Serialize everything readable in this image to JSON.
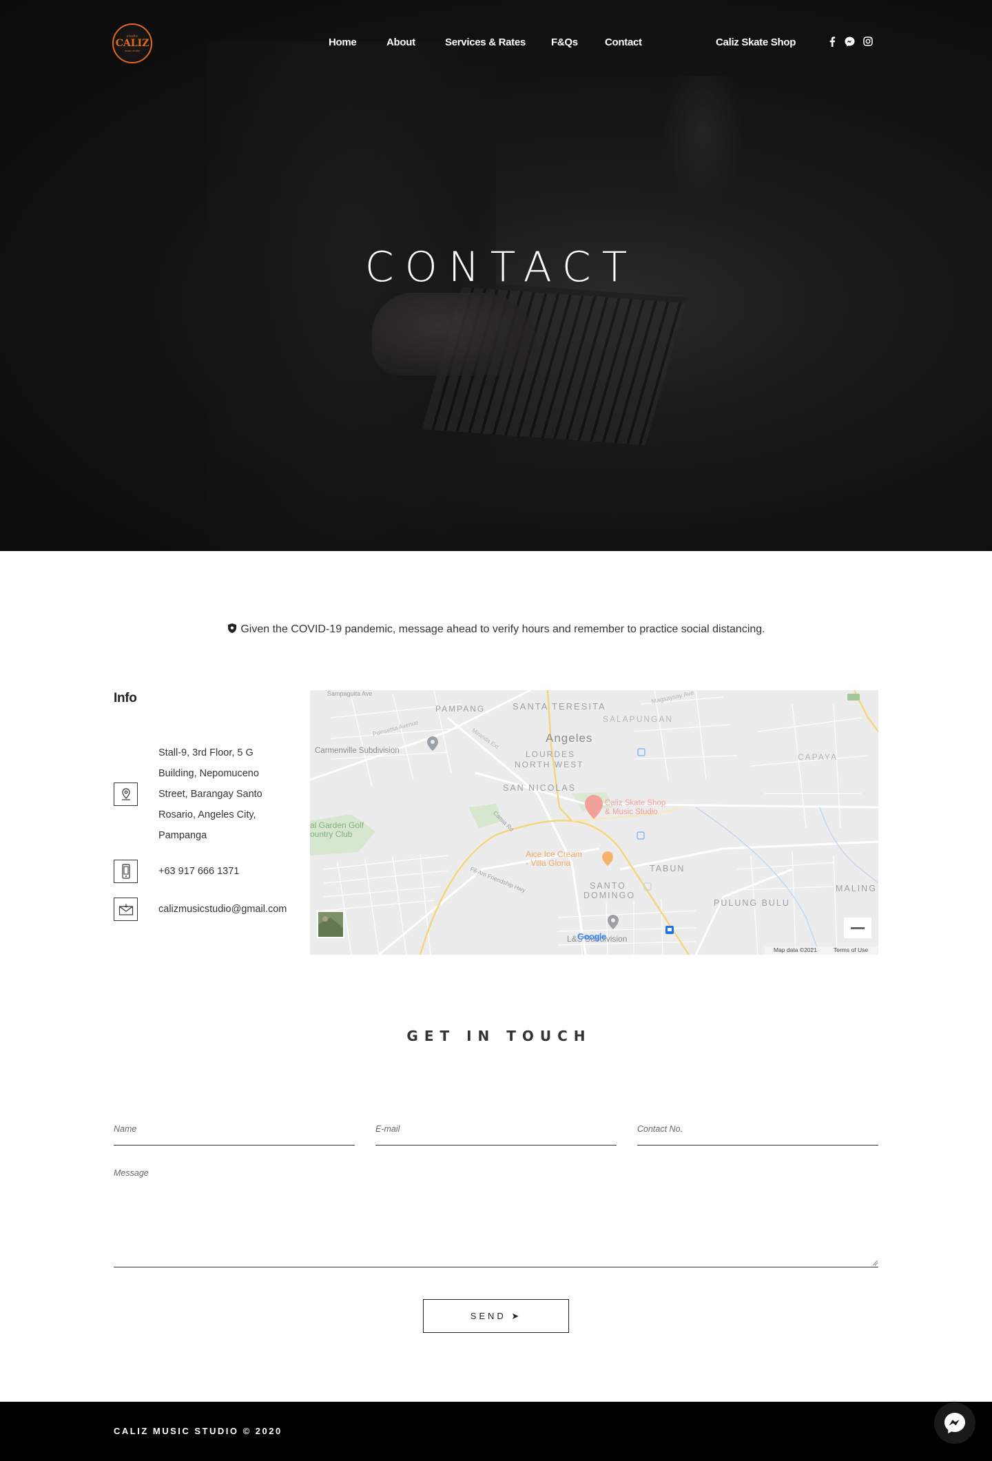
{
  "nav": {
    "items": [
      "Home",
      "About",
      "Services & Rates",
      "F&Qs",
      "Contact"
    ],
    "shop_link": "Caliz Skate Shop"
  },
  "logo": {
    "top": "studio",
    "mid": "CALIZ",
    "bot": "music studio"
  },
  "hero": {
    "title": "CONTACT"
  },
  "notice": {
    "text": "Given the COVID-19 pandemic, message ahead to verify hours and remember to practice social distancing."
  },
  "info": {
    "title": "Info",
    "address_lines": [
      "Stall-9, 3rd Floor, 5 G",
      "Building, Nepomuceno",
      "Street, Barangay Santo",
      "Rosario, Angeles City,",
      "Pampanga"
    ],
    "phone": "+63 917 666 1371",
    "email": "calizmusicstudio@gmail.com"
  },
  "map": {
    "labels": {
      "sampaguita": "Sampaguita Ave",
      "pampang": "PAMPANG",
      "santa_teresita": "SANTA TERESITA",
      "magsaysay": "Magsaysay Ave",
      "salapungan": "SALAPUNGAN",
      "angeles": "Angeles",
      "lourdes": "LOURDES",
      "north_west": "NORTH WEST",
      "carmenville": "Carmenville Subdivision",
      "poinsettia": "Poinsettia Avenue",
      "miranda": "Miranda Ext",
      "capaya": "CAPAYA",
      "san_nicolas": "SAN NICOLAS",
      "pin_line1": "Caliz Skate Shop",
      "pin_line2": "& Music Studio",
      "golf1": "al Garden Golf",
      "golf2": "ountry Club",
      "camia": "Camia Rd",
      "aice1": "Aice Ice Cream",
      "aice2": "- Villa Gloria",
      "tabun": "TABUN",
      "filam": "Fil-Am Friendship Hwy",
      "santo": "SANTO",
      "domingo": "DOMINGO",
      "pulung": "PULUNG BULU",
      "maling": "MALING",
      "ls": "L&S Subdivision",
      "google": "Google",
      "mapdata": "Map data ©2021",
      "terms": "Terms of Use"
    }
  },
  "form": {
    "title": "GET IN TOUCH",
    "name_placeholder": "Name",
    "email_placeholder": "E-mail",
    "contact_placeholder": "Contact No.",
    "message_placeholder": "Message",
    "send_label": "SEND ➤"
  },
  "footer": {
    "copyright": "CALIZ MUSIC STUDIO © 2020"
  },
  "colors": {
    "accent": "#e06a1a",
    "map_pin": "#ea4335",
    "map_bg": "#ececec"
  }
}
